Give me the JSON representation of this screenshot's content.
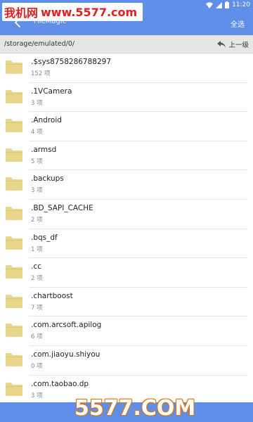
{
  "status_bar": {
    "time": "11:20"
  },
  "watermark_top": {
    "brand": "我机网",
    "url": "www.5577.com"
  },
  "app_bar": {
    "title": "FileMagic",
    "select_all": "全选"
  },
  "path_bar": {
    "path": "/storage/emulated/0/",
    "up_label": "上一级"
  },
  "files": [
    {
      "name": ".$sys8758286788297",
      "count": "152 项"
    },
    {
      "name": ".1VCamera",
      "count": "3 项"
    },
    {
      "name": ".Android",
      "count": "4 项"
    },
    {
      "name": ".armsd",
      "count": "5 项"
    },
    {
      "name": ".backups",
      "count": "3 项"
    },
    {
      "name": ".BD_SAPI_CACHE",
      "count": "2 项"
    },
    {
      "name": ".bqs_df",
      "count": "1 项"
    },
    {
      "name": ".cc",
      "count": "2 项"
    },
    {
      "name": ".chartboost",
      "count": "7 项"
    },
    {
      "name": ".com.arcsoft.apilog",
      "count": "6 项"
    },
    {
      "name": ".com.jiaoyu.shiyou",
      "count": "0 项"
    },
    {
      "name": ".com.taobao.dp",
      "count": "3 项"
    }
  ],
  "watermark_bottom": {
    "text": "5577.COM"
  },
  "colors": {
    "primary": "#5f8fe8",
    "folder": "#e8d68a",
    "watermark_red": "#e02020"
  }
}
